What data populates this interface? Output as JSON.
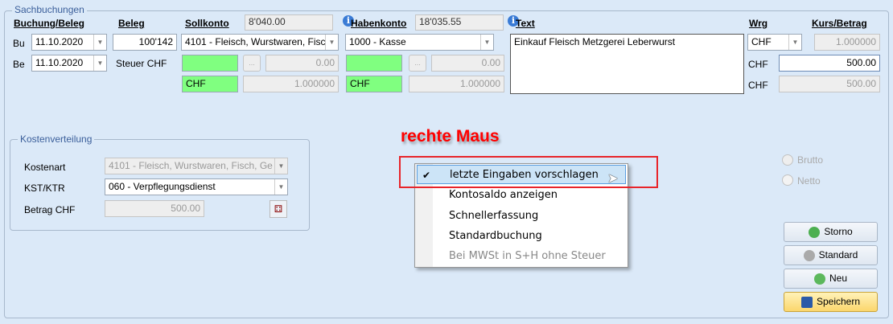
{
  "group_title": "Sachbuchungen",
  "headers": {
    "buchung_beleg": "Buchung/Beleg",
    "beleg": "Beleg",
    "sollkonto": "Sollkonto",
    "habenkonto": "Habenkonto",
    "text": "Text",
    "wrg": "Wrg",
    "kurs_betrag": "Kurs/Betrag"
  },
  "soll_saldo": "8'040.00",
  "haben_saldo": "18'035.55",
  "row_labels": {
    "bu": "Bu",
    "be": "Be",
    "steuer": "Steuer CHF"
  },
  "bu_date": "11.10.2020",
  "be_date": "11.10.2020",
  "beleg_nr": "100'142",
  "sollkonto": "4101 - Fleisch, Wurstwaren, Fisc",
  "habenkonto": "1000 - Kasse",
  "soll_steuer": "0.00",
  "haben_steuer": "0.00",
  "soll_wrg": "CHF",
  "soll_kurs": "1.000000",
  "haben_wrg": "CHF",
  "haben_kurs": "1.000000",
  "text": "Einkauf Fleisch Metzgerei Leberwurst",
  "wrg": "CHF",
  "kurs": "1.000000",
  "chf1": "CHF",
  "betrag": "500.00",
  "chf2": "CHF",
  "betrag2": "500.00",
  "kosten": {
    "title": "Kostenverteilung",
    "kostenart_label": "Kostenart",
    "kostenart": "4101 - Fleisch, Wurstwaren, Fisch, Ge",
    "kst_label": "KST/KTR",
    "kst": "060 - Verpflegungsdienst",
    "betrag_label": "Betrag CHF",
    "betrag": "500.00"
  },
  "annotation": "rechte Maus",
  "menu": [
    "letzte Eingaben vorschlagen",
    "Kontosaldo anzeigen",
    "Schnellerfassung",
    "Standardbuchung",
    "Bei MWSt in S+H ohne Steuer"
  ],
  "radio": {
    "brutto": "Brutto",
    "netto": "Netto"
  },
  "buttons": {
    "storno": "Storno",
    "standard": "Standard",
    "neu": "Neu",
    "speichern": "Speichern"
  }
}
